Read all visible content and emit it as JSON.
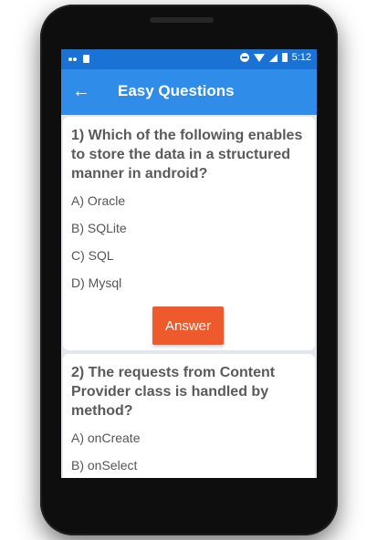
{
  "statusbar": {
    "time": "5:12"
  },
  "appbar": {
    "back_icon": "arrow-back-icon",
    "title": "Easy Questions"
  },
  "questions": [
    {
      "text": "1) Which of the following enables to store the data in a structured manner in android?",
      "options": [
        "A) Oracle",
        "B) SQLite",
        "C) SQL",
        "D) Mysql"
      ],
      "answer_label": "Answer"
    },
    {
      "text": "2) The requests from Content Provider class is handled by method?",
      "options": [
        "A) onCreate",
        "B) onSelect"
      ]
    }
  ],
  "colors": {
    "status_bar": "#1a73d4",
    "app_bar": "#2f8ce8",
    "answer_button": "#ef5a2c"
  }
}
